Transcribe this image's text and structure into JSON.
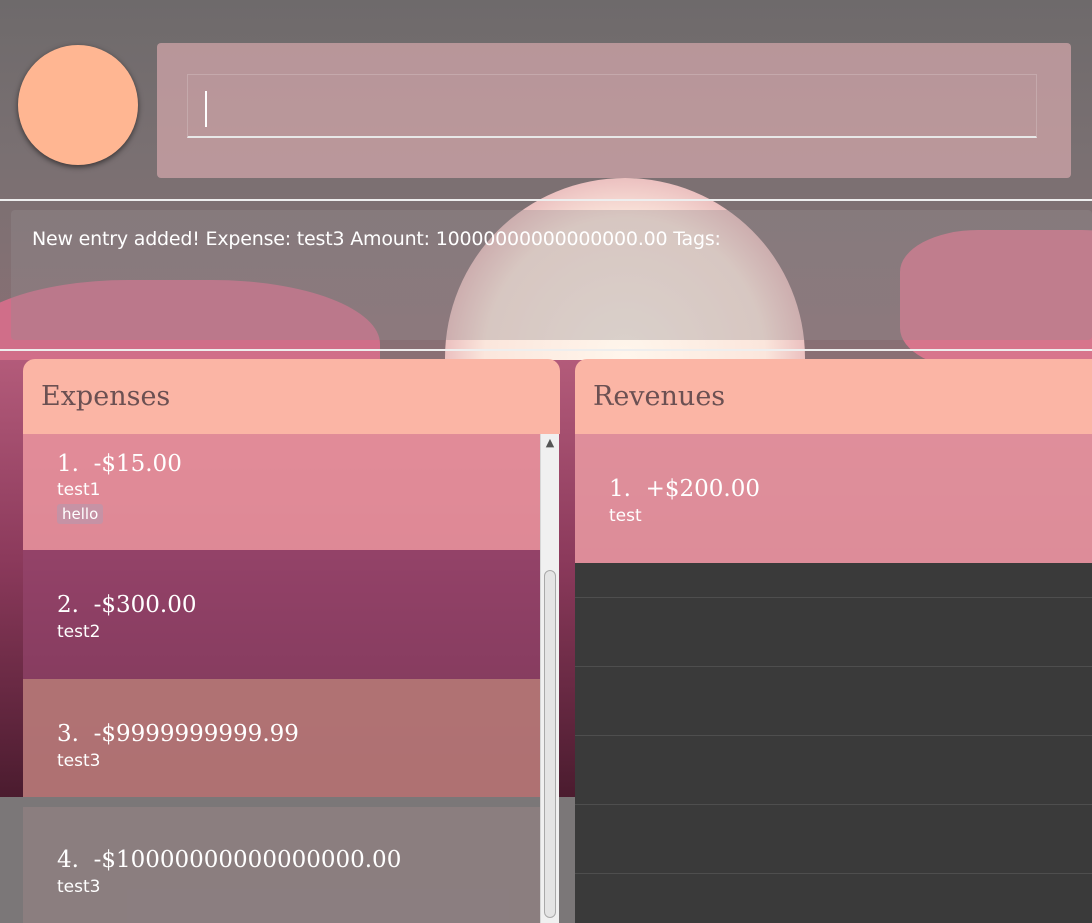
{
  "command": {
    "value": "",
    "placeholder": ""
  },
  "result": {
    "message": "New entry added! Expense: test3 Amount: 10000000000000000.00 Tags:"
  },
  "expenses": {
    "title": "Expenses",
    "items": [
      {
        "index": "1.",
        "amount": "-$15.00",
        "description": "test1",
        "tag": "hello"
      },
      {
        "index": "2.",
        "amount": "-$300.00",
        "description": "test2"
      },
      {
        "index": "3.",
        "amount": "-$9999999999.99",
        "description": "test3"
      },
      {
        "index": "4.",
        "amount": "-$10000000000000000.00",
        "description": "test3"
      }
    ]
  },
  "revenues": {
    "title": "Revenues",
    "items": [
      {
        "index": "1.",
        "amount": "+$200.00",
        "description": "test"
      }
    ]
  },
  "colors": {
    "avatar": "#ffb692",
    "panel_header": "#fbb5a5",
    "title_text": "#6b5052",
    "empty_list": "#3a3a3a"
  }
}
